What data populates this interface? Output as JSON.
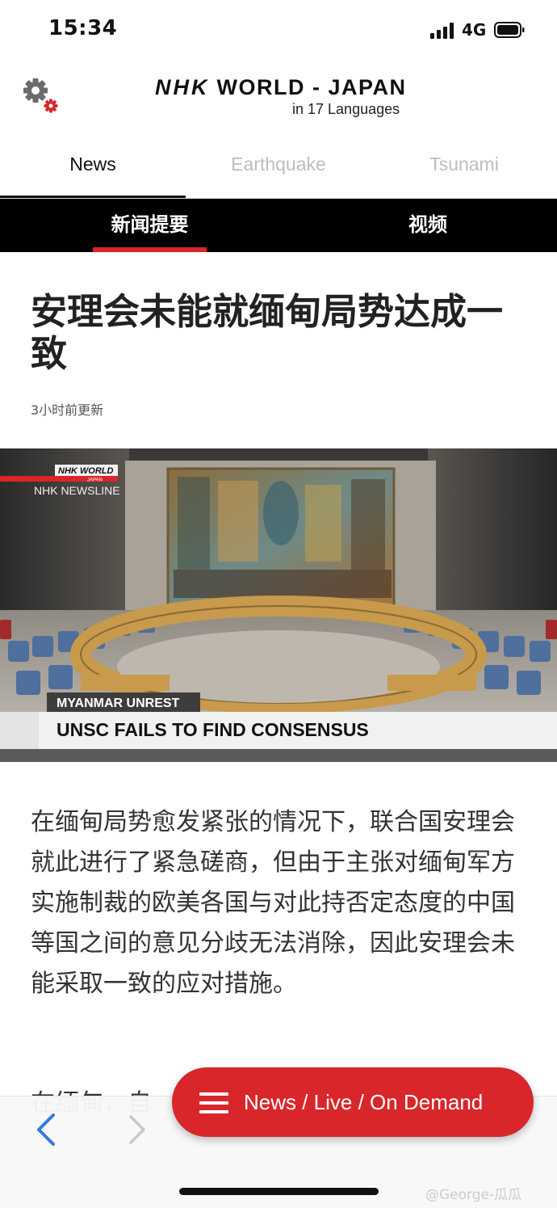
{
  "status_bar": {
    "time": "15:34",
    "network": "4G"
  },
  "app_header": {
    "brand_nhk": "NHK",
    "brand_rest": "WORLD - JAPAN",
    "languages": "in 17 Languages"
  },
  "top_tabs": [
    {
      "label": "News",
      "active": true
    },
    {
      "label": "Earthquake",
      "active": false
    },
    {
      "label": "Tsunami",
      "active": false
    }
  ],
  "sub_tabs": [
    {
      "label": "新闻提要",
      "active": true
    },
    {
      "label": "视频",
      "active": false
    }
  ],
  "article": {
    "headline": "安理会未能就缅甸局势达成一致",
    "updated": "3小时前更新",
    "image": {
      "logo_top": "NHK WORLD",
      "logo_sub": "JAPAN",
      "program": "NHK NEWSLINE",
      "chyron_kicker": "MYANMAR UNREST",
      "chyron_title": "UNSC FAILS TO FIND CONSENSUS"
    },
    "body": "在缅甸局势愈发紧张的情况下，联合国安理会就此进行了紧急磋商，但由于主张对缅甸军方实施制裁的欧美各国与对此持否定态度的中国等国之间的意见分歧无法消除，因此安理会未能采取一致的应对措施。",
    "next_paragraph_partial": "在缅甸，自"
  },
  "fab": {
    "label": "News / Live / On Demand"
  },
  "watermark": "@George-瓜瓜",
  "colors": {
    "accent_red": "#d8262a",
    "sub_tab_bg": "#000000",
    "ios_blue": "#2f7be0"
  },
  "icons": [
    "settings-gear-icon",
    "menu-icon",
    "back-chevron-icon",
    "forward-chevron-icon",
    "signal-icon",
    "battery-icon"
  ]
}
